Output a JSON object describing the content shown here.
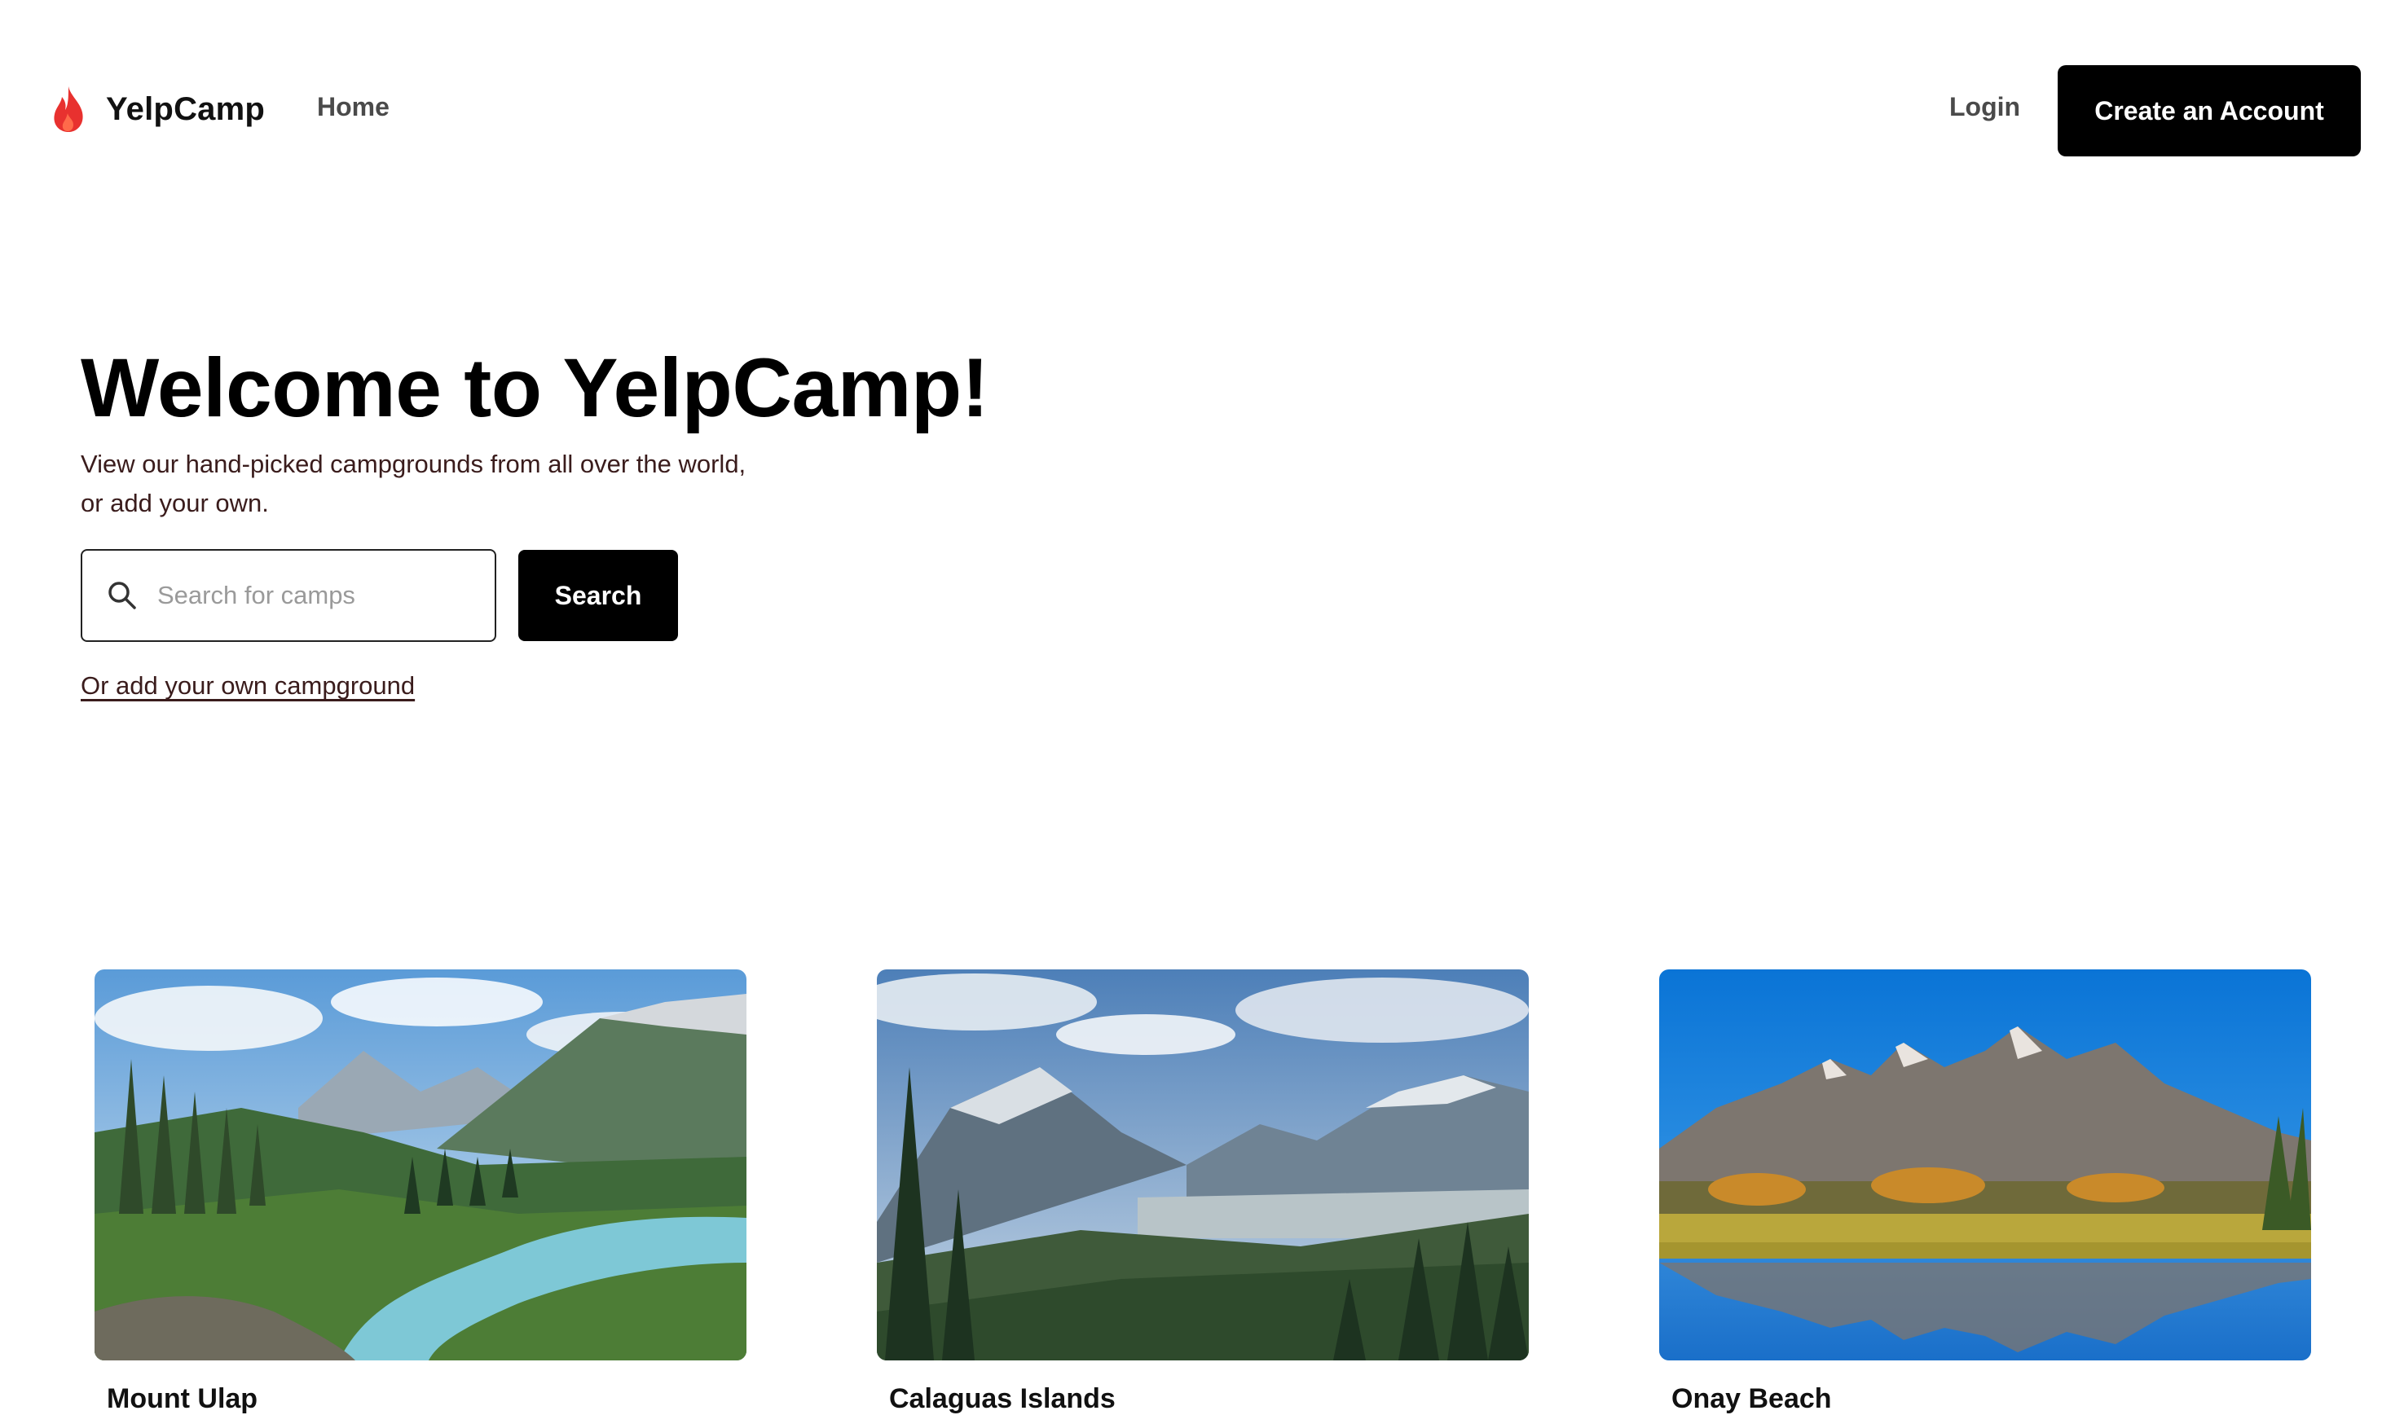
{
  "header": {
    "brand": "YelpCamp",
    "nav_home": "Home",
    "login": "Login",
    "create_account": "Create an Account",
    "brand_icon": "flame-icon",
    "brand_color": "#e8312f"
  },
  "hero": {
    "title": "Welcome to YelpCamp!",
    "subtitle": "View our hand-picked campgrounds from all over the world, or add your own.",
    "search": {
      "placeholder": "Search for camps",
      "value": "",
      "icon": "search-icon",
      "button_label": "Search"
    },
    "add_link": "Or add your own campground"
  },
  "campgrounds": [
    {
      "title": "Mount Ulap"
    },
    {
      "title": "Calaguas Islands"
    },
    {
      "title": "Onay Beach"
    }
  ]
}
